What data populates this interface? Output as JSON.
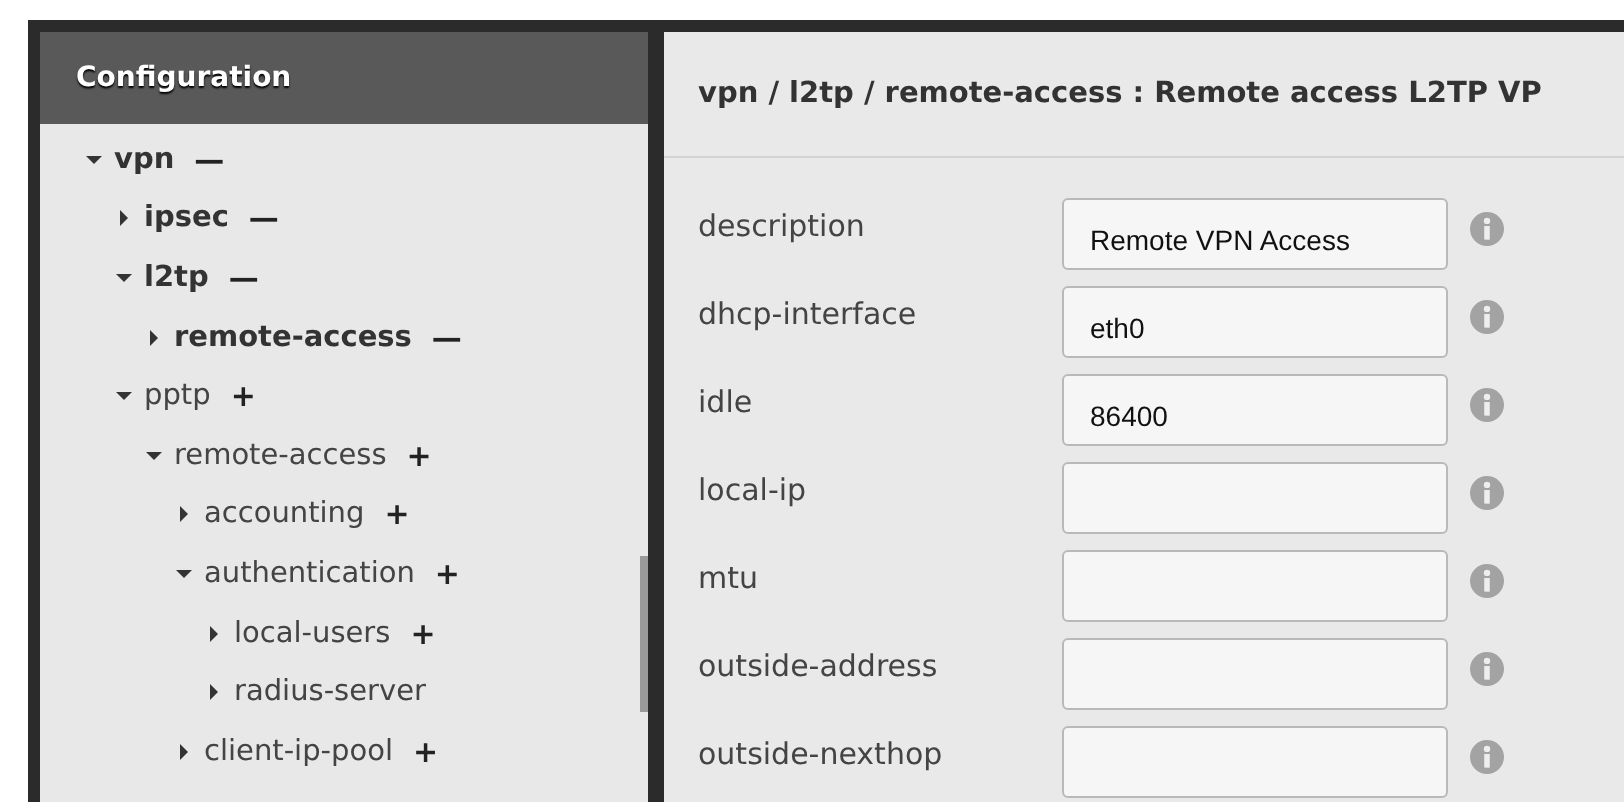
{
  "sidebar": {
    "title": "Configuration",
    "tree": [
      {
        "label": "vpn",
        "expanded": true,
        "configured": true,
        "action": "—",
        "children": [
          {
            "label": "ipsec",
            "expanded": false,
            "configured": true,
            "action": "—"
          },
          {
            "label": "l2tp",
            "expanded": true,
            "configured": true,
            "action": "—",
            "children": [
              {
                "label": "remote-access",
                "expanded": false,
                "configured": true,
                "action": "—"
              }
            ]
          },
          {
            "label": "pptp",
            "expanded": true,
            "configured": false,
            "action": "+",
            "children": [
              {
                "label": "remote-access",
                "expanded": true,
                "configured": false,
                "action": "+",
                "children": [
                  {
                    "label": "accounting",
                    "expanded": false,
                    "configured": false,
                    "action": "+"
                  },
                  {
                    "label": "authentication",
                    "expanded": true,
                    "configured": false,
                    "action": "+",
                    "children": [
                      {
                        "label": "local-users",
                        "expanded": false,
                        "configured": false,
                        "action": "+"
                      },
                      {
                        "label": "radius-server",
                        "expanded": false,
                        "configured": false
                      }
                    ]
                  },
                  {
                    "label": "client-ip-pool",
                    "expanded": false,
                    "configured": false,
                    "action": "+"
                  }
                ]
              }
            ]
          }
        ]
      }
    ]
  },
  "panel": {
    "title": "vpn / l2tp / remote-access : Remote access L2TP VP",
    "fields": [
      {
        "label": "description",
        "value": "Remote VPN Access"
      },
      {
        "label": "dhcp-interface",
        "value": "eth0"
      },
      {
        "label": "idle",
        "value": "86400"
      },
      {
        "label": "local-ip"
      },
      {
        "label": "mtu"
      },
      {
        "label": "outside-address"
      },
      {
        "label": "outside-nexthop"
      }
    ]
  }
}
